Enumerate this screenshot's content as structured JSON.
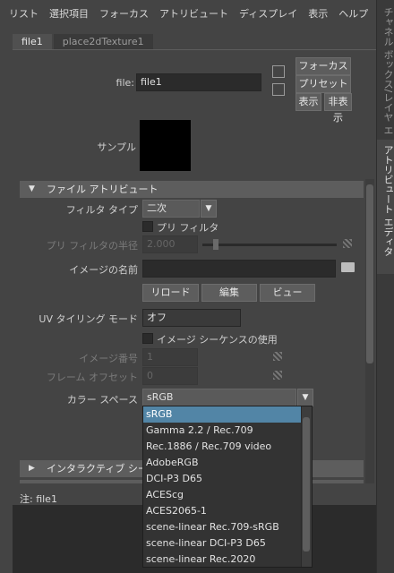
{
  "menu": [
    "リスト",
    "選択項目",
    "フォーカス",
    "アトリビュート",
    "ディスプレイ",
    "表示",
    "ヘルプ"
  ],
  "vtabs": [
    "チャネル ボックス/レイヤ エディタ",
    "アトリビュート エディタ"
  ],
  "node_tabs": [
    "file1",
    "place2dTexture1"
  ],
  "file_row": {
    "label": "file:",
    "value": "file1"
  },
  "buttons": {
    "focus": "フォーカス",
    "preset": "プリセット",
    "show": "表示",
    "hide": "非表示"
  },
  "sample_label": "サンプル",
  "file_attributes": {
    "header": "ファイル アトリビュート",
    "filter_type_label": "フィルタ タイプ",
    "filter_type_value": "二次",
    "prefilter_label": "プリ フィルタ",
    "prefilter_radius_label": "プリ フィルタの半径",
    "prefilter_radius_value": "2.000",
    "image_name_label": "イメージの名前",
    "image_name_value": "",
    "reload": "リロード",
    "edit": "編集",
    "view": "ビュー",
    "uv_tiling_label": "UV タイリング モード",
    "uv_tiling_value": "オフ",
    "use_sequence_label": "イメージ シーケンスの使用",
    "image_number_label": "イメージ番号",
    "image_number_value": "1",
    "frame_offset_label": "フレーム オフセット",
    "frame_offset_value": "0",
    "color_space_label": "カラー スペース",
    "color_space_value": "sRGB"
  },
  "interactive_header": "インタラクティブ シーケンス",
  "notes_label": "注:  file1",
  "dropdown_options": [
    "sRGB",
    "Gamma 2.2 / Rec.709",
    "Rec.1886 / Rec.709 video",
    "AdobeRGB",
    "DCI-P3 D65",
    "ACEScg",
    "ACES2065-1",
    "scene-linear Rec.709-sRGB",
    "scene-linear DCI-P3 D65",
    "scene-linear Rec.2020"
  ],
  "colors": {
    "selected_option": "#5285a6",
    "panel": "#444444",
    "field": "#2b2b2b"
  }
}
